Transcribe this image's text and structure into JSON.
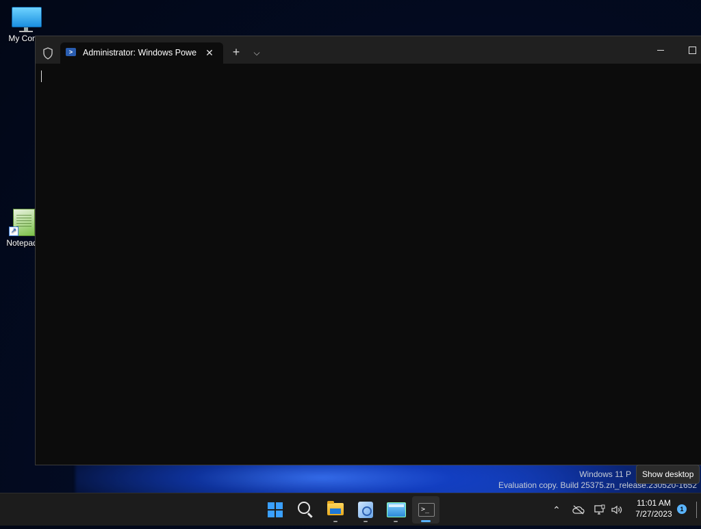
{
  "desktop": {
    "icons": [
      {
        "label": "My Comp"
      },
      {
        "label": "Notepad"
      }
    ]
  },
  "terminal": {
    "tab_title": "Administrator: Windows Powe",
    "tab_close": "✕",
    "new_tab": "+",
    "dropdown": "⌵"
  },
  "watermark": {
    "line1": "Windows 11 P",
    "line2": "Evaluation copy. Build 25375.zn_release.230520-1652"
  },
  "tooltip": {
    "text": "Show desktop"
  },
  "taskbar": {
    "apps": [
      {
        "name": "start-button"
      },
      {
        "name": "search-button"
      },
      {
        "name": "file-explorer-button"
      },
      {
        "name": "control-panel-button"
      },
      {
        "name": "remote-desktop-button"
      },
      {
        "name": "terminal-button"
      }
    ],
    "tray": {
      "chevron": "⌃",
      "time": "11:01 AM",
      "date": "7/27/2023",
      "notifications": "1"
    }
  },
  "colors": {
    "accent": "#3aa0ff",
    "terminal_bg": "#0c0c0c",
    "titlebar_bg": "#202020",
    "taskbar_bg": "#1c1c1c"
  }
}
